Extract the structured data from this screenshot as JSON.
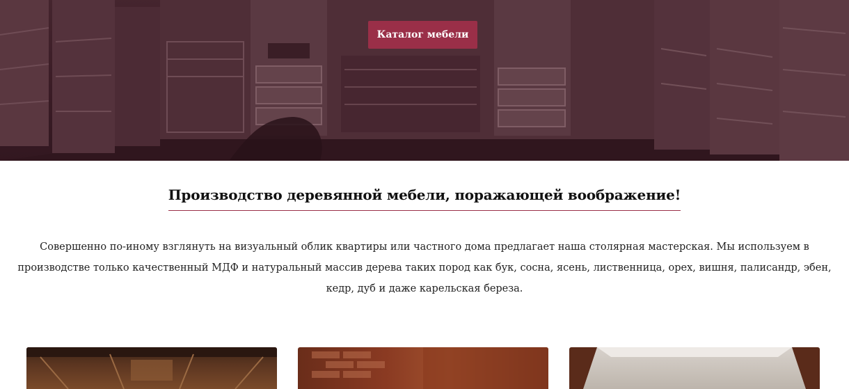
{
  "hero": {
    "catalog_button_label": "Каталог мебели"
  },
  "section": {
    "headline": "Производство деревянной мебели, поражающей воображение!",
    "intro": "Совершенно по-иному взглянуть на визуальный облик квартиры или частного дома предлагает наша столярная мастерская. Мы используем в производстве только качественный МДФ и натуральный массив дерева таких пород как бук, сосна, ясень, лиственница, орех, вишня, палисандр, эбен, кедр, дуб и даже карельская береза."
  },
  "colors": {
    "accent": "#9a2f48",
    "hero_tint": "#3a2128"
  }
}
